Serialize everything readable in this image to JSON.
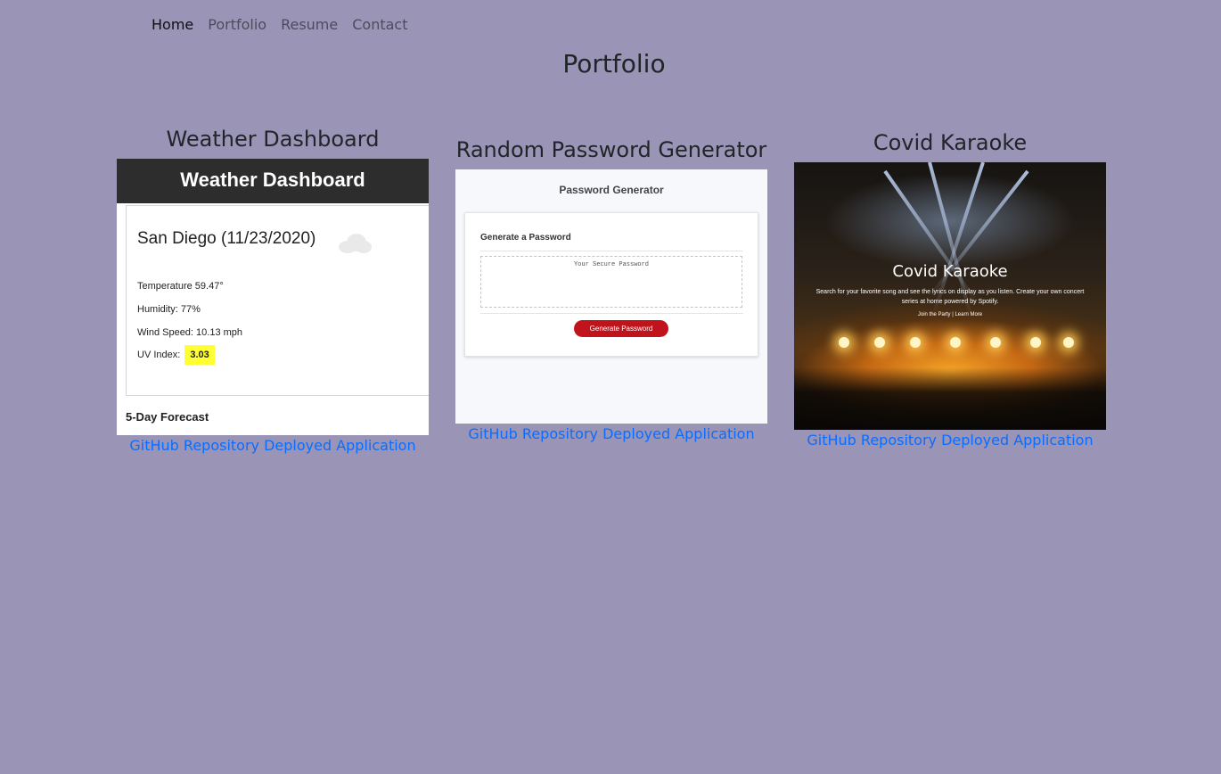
{
  "nav": {
    "items": [
      {
        "label": "Home"
      },
      {
        "label": "Portfolio"
      },
      {
        "label": "Resume"
      },
      {
        "label": "Contact"
      }
    ]
  },
  "page_title": "Portfolio",
  "projects": [
    {
      "title": "Weather Dashboard",
      "repo_label": "GitHub Repository",
      "app_label": "Deployed Application",
      "thumbnail": {
        "header": "Weather Dashboard",
        "city": "San Diego (11/23/2020)",
        "icon": "cloud-icon",
        "temperature": "Temperature 59.47°",
        "humidity": "Humidity: 77%",
        "wind": "Wind Speed: 10.13 mph",
        "uv_label": "UV Index:",
        "uv_value": "3.03",
        "forecast": "5-Day Forecast"
      }
    },
    {
      "title": "Random Password Generator",
      "repo_label": "GitHub Repository",
      "app_label": "Deployed Application",
      "thumbnail": {
        "header": "Password Generator",
        "card_title": "Generate a Password",
        "placeholder": "Your Secure Password",
        "button": "Generate Password"
      }
    },
    {
      "title": "Covid Karaoke",
      "repo_label": "GitHub Repository",
      "app_label": "Deployed Application",
      "thumbnail": {
        "title": "Covid Karaoke",
        "subtitle": "Search for your favorite song and see the lyrics on display as you listen. Create your own concert series at home powered by Spotify.",
        "cta": "Join the Party | Learn More"
      }
    }
  ],
  "colors": {
    "background": "#9a94b6",
    "link": "#0b6dff",
    "uv_highlight": "#ffff33",
    "generate_button": "#c0131b"
  }
}
